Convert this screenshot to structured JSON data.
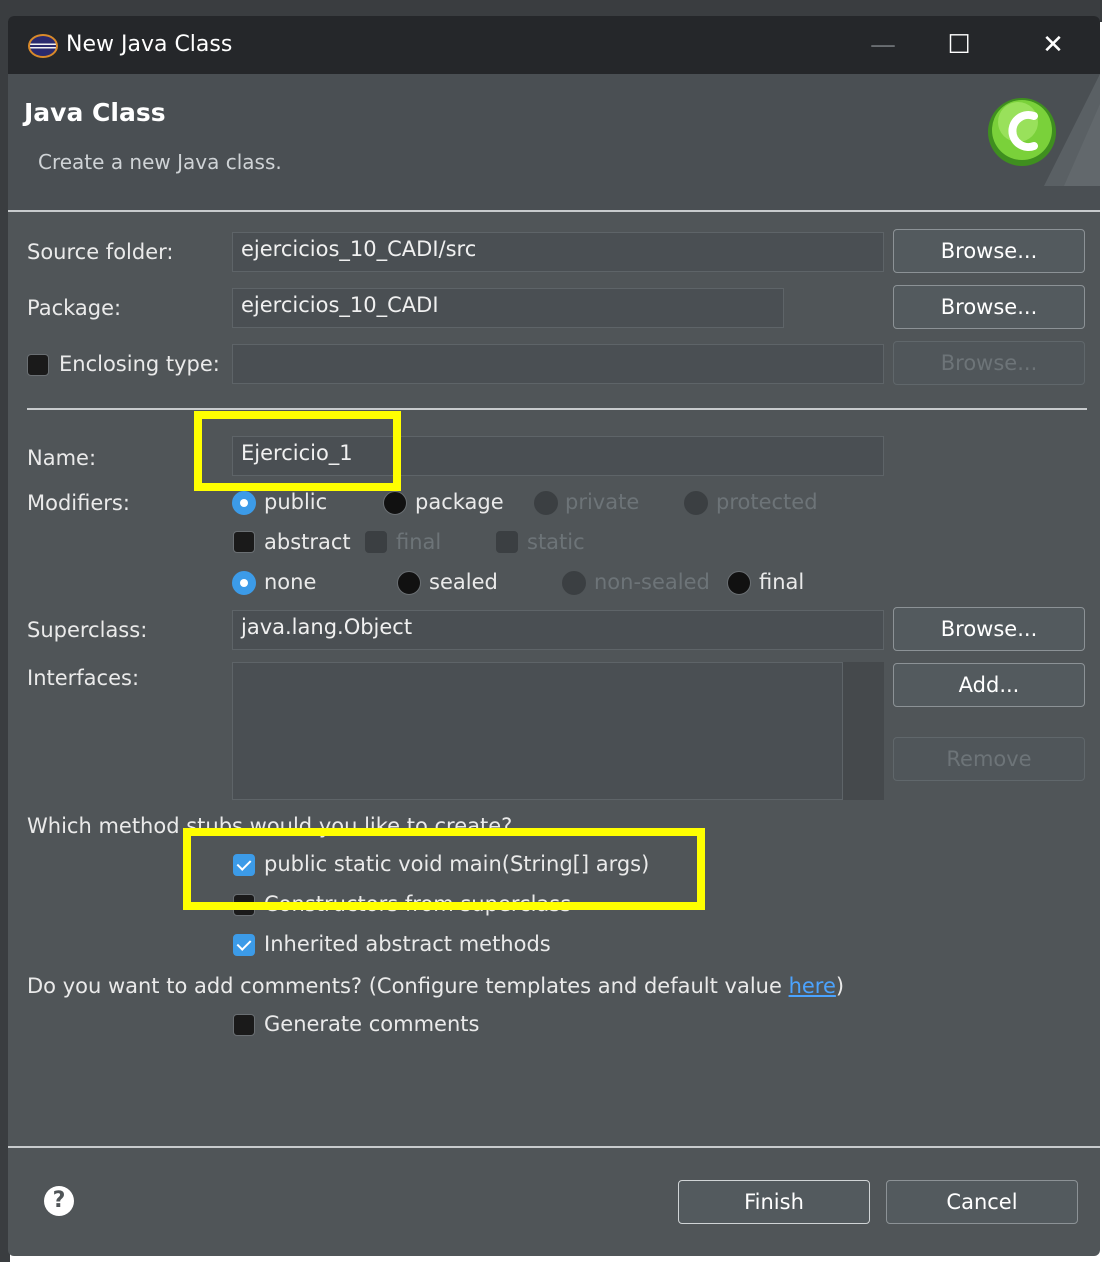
{
  "window": {
    "title": "New Java Class",
    "minimize_glyph": "—",
    "maximize_glyph": "☐",
    "close_glyph": "✕"
  },
  "header": {
    "title": "Java Class",
    "description": "Create a new Java class."
  },
  "fields": {
    "source_folder_label": "Source folder:",
    "source_folder_value": "ejercicios_10_CADI/src",
    "package_label": "Package:",
    "package_value": "ejercicios_10_CADI",
    "enclosing_type_label": "Enclosing type:",
    "enclosing_type_checked": false,
    "enclosing_type_value": "",
    "name_label": "Name:",
    "name_value": "Ejercicio_1",
    "modifiers_label": "Modifiers:",
    "superclass_label": "Superclass:",
    "superclass_value": "java.lang.Object",
    "interfaces_label": "Interfaces:"
  },
  "buttons": {
    "browse_source": "Browse...",
    "browse_package": "Browse...",
    "browse_enclosing": "Browse...",
    "browse_superclass": "Browse...",
    "add_interface": "Add...",
    "remove_interface": "Remove",
    "finish": "Finish",
    "cancel": "Cancel"
  },
  "modifiers": {
    "access": [
      {
        "label": "public",
        "selected": true,
        "enabled": true
      },
      {
        "label": "package",
        "selected": false,
        "enabled": true
      },
      {
        "label": "private",
        "selected": false,
        "enabled": false
      },
      {
        "label": "protected",
        "selected": false,
        "enabled": false
      }
    ],
    "flags": [
      {
        "label": "abstract",
        "checked": false,
        "enabled": true
      },
      {
        "label": "final",
        "checked": false,
        "enabled": false
      },
      {
        "label": "static",
        "checked": false,
        "enabled": false
      }
    ],
    "sealing": [
      {
        "label": "none",
        "selected": true,
        "enabled": true
      },
      {
        "label": "sealed",
        "selected": false,
        "enabled": true
      },
      {
        "label": "non-sealed",
        "selected": false,
        "enabled": false
      },
      {
        "label": "final",
        "selected": false,
        "enabled": true
      }
    ]
  },
  "stubs": {
    "question": "Which method stubs would you like to create?",
    "items": [
      {
        "label": "public static void main(String[] args)",
        "checked": true
      },
      {
        "label": "Constructors from superclass",
        "checked": false
      },
      {
        "label": "Inherited abstract methods",
        "checked": true
      }
    ]
  },
  "comments": {
    "question_prefix": "Do you want to add comments? (Configure templates and default value ",
    "link_text": "here",
    "question_suffix": ")",
    "generate_label": "Generate comments",
    "generate_checked": false
  },
  "footer": {
    "help_glyph": "?"
  },
  "colors": {
    "dialog_bg": "#505558",
    "titlebar_bg": "#25272a",
    "accent": "#3c9be8",
    "highlight": "#ffff00",
    "link": "#4ba3ff"
  },
  "icons": [
    "eclipse-icon",
    "java-class-wizard-icon",
    "help-icon"
  ]
}
